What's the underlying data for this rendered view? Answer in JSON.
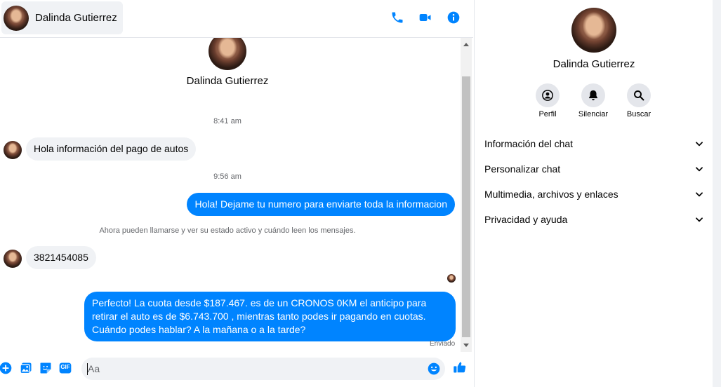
{
  "header": {
    "contact_name": "Dalinda Gutierrez",
    "icons": {
      "call": "phone-icon",
      "video": "video-camera-icon",
      "info": "info-icon"
    }
  },
  "conversation": {
    "contact_name": "Dalinda Gutierrez",
    "timestamps": [
      "8:41 am",
      "9:56 am"
    ],
    "messages": [
      {
        "direction": "incoming",
        "text": "Hola información del pago de autos"
      },
      {
        "direction": "outgoing",
        "text": "Hola! Dejame tu numero  para enviarte toda la informacion"
      },
      {
        "direction": "incoming",
        "text": "3821454085"
      },
      {
        "direction": "outgoing",
        "text": "Perfecto! La cuota desde $187.467. es de un CRONOS 0KM el anticipo para retirar el auto es de $6.743.700 , mientras tanto podes ir pagando en cuotas. Cuándo podes hablar? A la mañana o a la tarde?"
      }
    ],
    "system_note": "Ahora pueden llamarse y ver su estado activo y cuándo leen los mensajes.",
    "delivery_status": "Enviado"
  },
  "composer": {
    "placeholder": "Aa",
    "icons": [
      "plus-circle-icon",
      "image-icon",
      "sticker-icon",
      "gif-icon",
      "emoji-icon",
      "thumbs-up-icon"
    ],
    "gif_label": "GIF"
  },
  "panel": {
    "contact_name": "Dalinda Gutierrez",
    "actions": [
      {
        "label": "Perfil",
        "icon": "profile-icon"
      },
      {
        "label": "Silenciar",
        "icon": "bell-icon"
      },
      {
        "label": "Buscar",
        "icon": "search-icon"
      }
    ],
    "sections": [
      "Información del chat",
      "Personalizar chat",
      "Multimedia, archivos y enlaces",
      "Privacidad y ayuda"
    ]
  },
  "colors": {
    "accent": "#0084ff",
    "bubble_in": "#f0f2f5",
    "muted_text": "#65676b"
  }
}
